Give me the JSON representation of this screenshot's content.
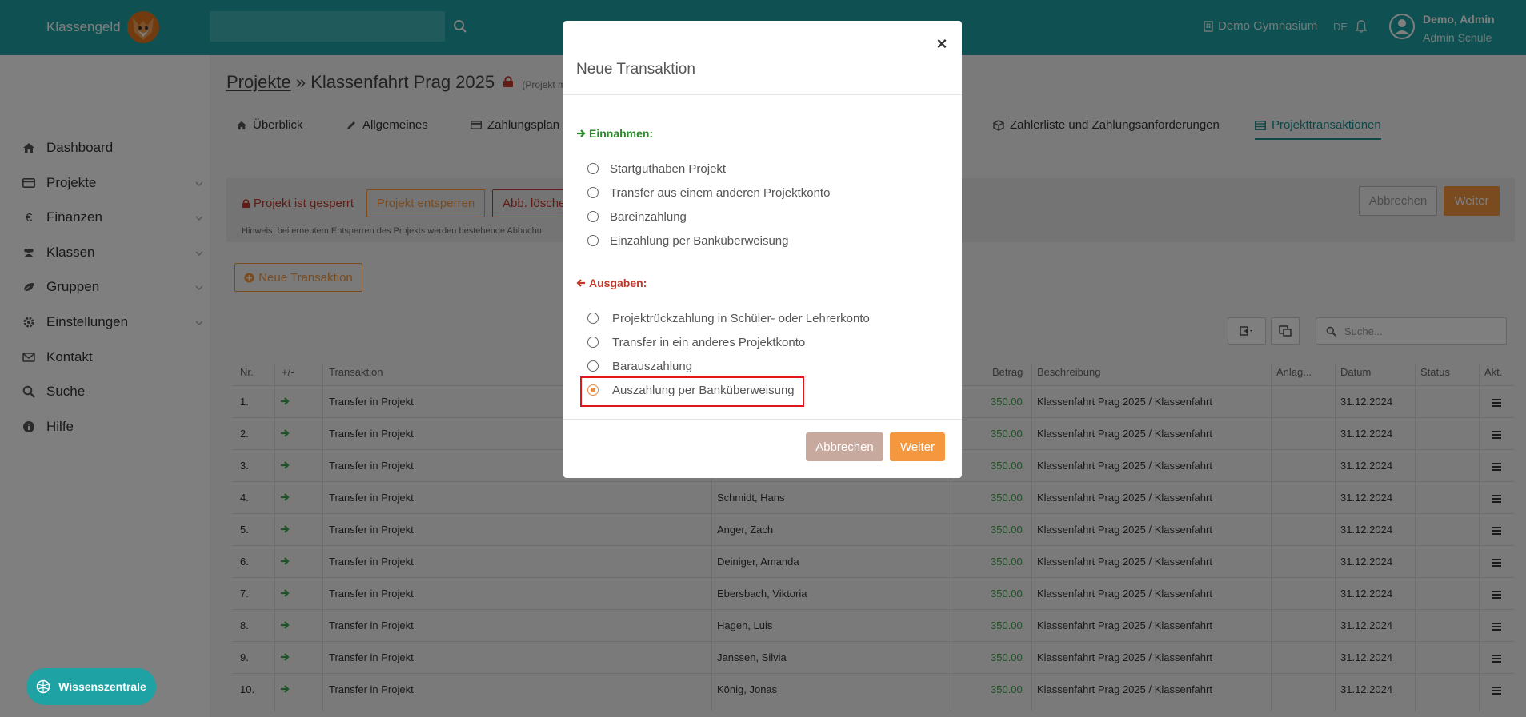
{
  "header": {
    "brand": "Klassengeld",
    "search_placeholder": "",
    "school": "Demo Gymnasium",
    "lang": "DE",
    "user_name": "Demo, Admin",
    "user_role": "Admin Schule",
    "accent": "#1fa2a4"
  },
  "sidebar": {
    "items": [
      {
        "label": "Dashboard",
        "icon": "home-icon"
      },
      {
        "label": "Projekte",
        "icon": "credit-card-icon"
      },
      {
        "label": "Finanzen",
        "icon": "euro-icon"
      },
      {
        "label": "Klassen",
        "icon": "users-icon"
      },
      {
        "label": "Gruppen",
        "icon": "leaf-icon"
      },
      {
        "label": "Einstellungen",
        "icon": "gear-icon"
      },
      {
        "label": "Kontakt",
        "icon": "envelope-icon"
      },
      {
        "label": "Suche",
        "icon": "search-icon"
      },
      {
        "label": "Hilfe",
        "icon": "info-icon"
      }
    ],
    "knowledge_button": "Wissenszentrale"
  },
  "page": {
    "crumb_link": "Projekte",
    "crumb_sep": " » ",
    "crumb_title": "Klassenfahrt Prag 2025",
    "crumb_note": "(Projekt m",
    "tabs": [
      "Überblick",
      "Allgemeines",
      "Zahlungsplan",
      "Zahlerliste und Zahlungsanforderungen",
      "Projekttransaktionen"
    ],
    "locked_text": "Projekt ist gesperrt",
    "unlock_button": "Projekt entsperren",
    "delete_button": "Abb. lösche",
    "hint": "Hinweis: bei erneutem Entsperren des Projekts werden bestehende Abbuchu",
    "cancel_button": "Abbrechen",
    "next_button": "Weiter",
    "new_transaction_button": "Neue Transaktion",
    "table_search_placeholder": "Suche...",
    "columns": [
      "Nr.",
      "+/-",
      "Transaktion",
      "Betrag",
      "Beschreibung",
      "Anlag...",
      "Datum",
      "Status",
      "Akt."
    ],
    "rows": [
      {
        "nr": "1.",
        "trans": "Transfer in Projekt",
        "name": "",
        "amount": "350.00",
        "desc": "Klassenfahrt Prag 2025 / Klassenfahrt",
        "date": "31.12.2024"
      },
      {
        "nr": "2.",
        "trans": "Transfer in Projekt",
        "name": "",
        "amount": "350.00",
        "desc": "Klassenfahrt Prag 2025 / Klassenfahrt",
        "date": "31.12.2024"
      },
      {
        "nr": "3.",
        "trans": "Transfer in Projekt",
        "name": "",
        "amount": "350.00",
        "desc": "Klassenfahrt Prag 2025 / Klassenfahrt",
        "date": "31.12.2024"
      },
      {
        "nr": "4.",
        "trans": "Transfer in Projekt",
        "name": "Schmidt, Hans",
        "amount": "350.00",
        "desc": "Klassenfahrt Prag 2025 / Klassenfahrt",
        "date": "31.12.2024"
      },
      {
        "nr": "5.",
        "trans": "Transfer in Projekt",
        "name": "Anger, Zach",
        "amount": "350.00",
        "desc": "Klassenfahrt Prag 2025 / Klassenfahrt",
        "date": "31.12.2024"
      },
      {
        "nr": "6.",
        "trans": "Transfer in Projekt",
        "name": "Deiniger, Amanda",
        "amount": "350.00",
        "desc": "Klassenfahrt Prag 2025 / Klassenfahrt",
        "date": "31.12.2024"
      },
      {
        "nr": "7.",
        "trans": "Transfer in Projekt",
        "name": "Ebersbach, Viktoria",
        "amount": "350.00",
        "desc": "Klassenfahrt Prag 2025 / Klassenfahrt",
        "date": "31.12.2024"
      },
      {
        "nr": "8.",
        "trans": "Transfer in Projekt",
        "name": "Hagen, Luis",
        "amount": "350.00",
        "desc": "Klassenfahrt Prag 2025 / Klassenfahrt",
        "date": "31.12.2024"
      },
      {
        "nr": "9.",
        "trans": "Transfer in Projekt",
        "name": "Janssen, Silvia",
        "amount": "350.00",
        "desc": "Klassenfahrt Prag 2025 / Klassenfahrt",
        "date": "31.12.2024"
      },
      {
        "nr": "10.",
        "trans": "Transfer in Projekt",
        "name": "König, Jonas",
        "amount": "350.00",
        "desc": "Klassenfahrt Prag 2025 / Klassenfahrt",
        "date": "31.12.2024"
      }
    ]
  },
  "modal": {
    "title": "Neue Transaktion",
    "close": "×",
    "income_title": "Einnahmen:",
    "income_options": [
      "Startguthaben Projekt",
      "Transfer aus einem anderen Projektkonto",
      "Bareinzahlung",
      "Einzahlung per Banküberweisung"
    ],
    "expense_title": "Ausgaben:",
    "expense_options": [
      "Projektrückzahlung in Schüler- oder Lehrerkonto",
      "Transfer in ein anderes Projektkonto",
      "Barauszahlung",
      "Auszahlung per Banküberweisung"
    ],
    "selected_option": "Auszahlung per Banküberweisung",
    "cancel_button": "Abbrechen",
    "next_button": "Weiter",
    "colors": {
      "income": "#2a8a2a",
      "expense": "#c0392b",
      "primary": "#f5973f",
      "secondary": "#c8a99e"
    }
  }
}
